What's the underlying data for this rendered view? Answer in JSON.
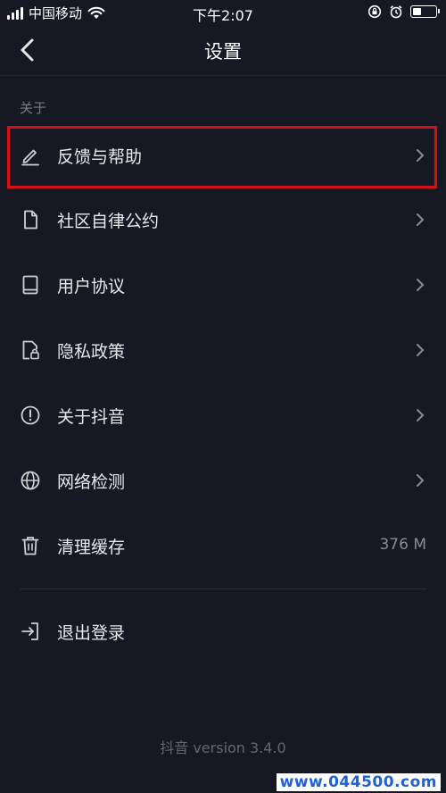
{
  "status_bar": {
    "carrier": "中国移动",
    "time": "下午2:07"
  },
  "nav": {
    "title": "设置"
  },
  "section": {
    "label": "关于"
  },
  "items": [
    {
      "label": "反馈与帮助",
      "icon": "edit-pen-icon"
    },
    {
      "label": "社区自律公约",
      "icon": "document-icon"
    },
    {
      "label": "用户协议",
      "icon": "book-icon"
    },
    {
      "label": "隐私政策",
      "icon": "privacy-lock-icon"
    },
    {
      "label": "关于抖音",
      "icon": "info-circle-icon"
    },
    {
      "label": "网络检测",
      "icon": "globe-icon"
    },
    {
      "label": "清理缓存",
      "icon": "trash-icon",
      "value": "376 M"
    }
  ],
  "logout": {
    "label": "退出登录",
    "icon": "logout-icon"
  },
  "footer": {
    "version": "抖音 version 3.4.0"
  },
  "watermark": {
    "text": "www.044500.com"
  },
  "colors": {
    "background": "#161823",
    "highlight": "#d6101a"
  }
}
